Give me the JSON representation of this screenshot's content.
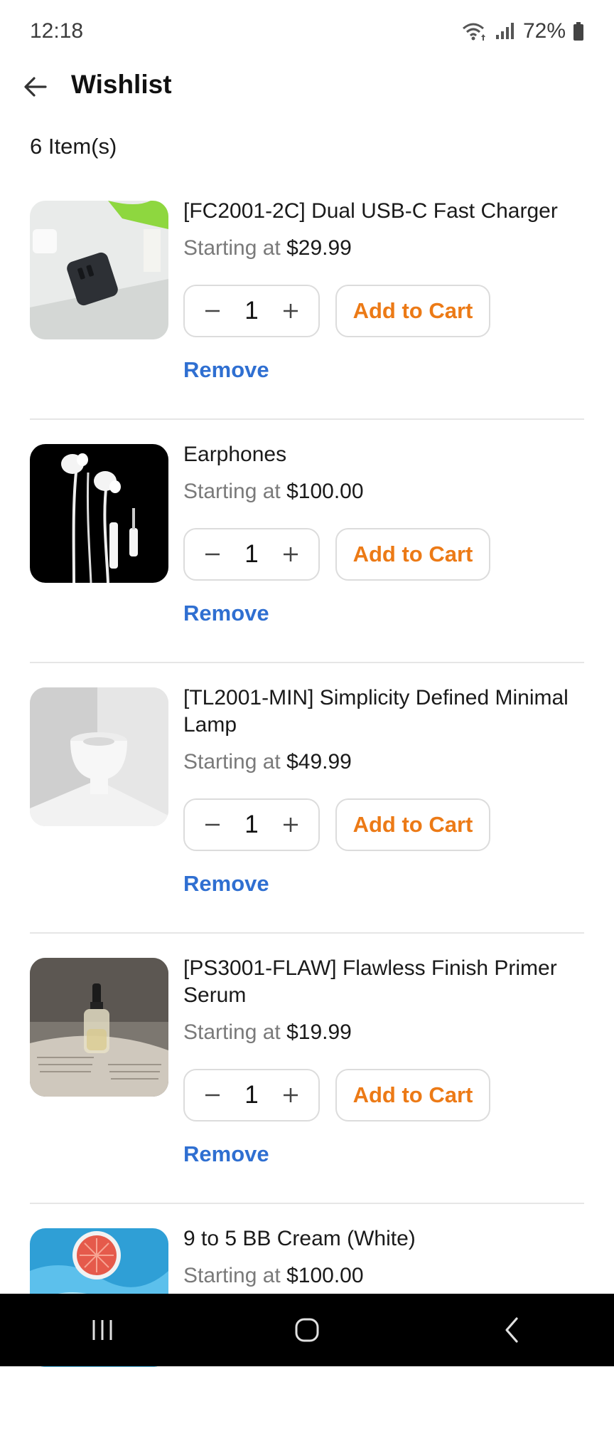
{
  "status_bar": {
    "time": "12:18",
    "battery": "72%"
  },
  "header": {
    "title": "Wishlist"
  },
  "summary": {
    "count_label": "6 Item(s)"
  },
  "items": [
    {
      "title": "[FC2001-2C] Dual USB-C Fast Charger",
      "price_prefix": "Starting at",
      "price": "$29.99",
      "qty": "1",
      "add_label": "Add to Cart",
      "remove_label": "Remove"
    },
    {
      "title": "Earphones",
      "price_prefix": "Starting at",
      "price": "$100.00",
      "qty": "1",
      "add_label": "Add to Cart",
      "remove_label": "Remove"
    },
    {
      "title": "[TL2001-MIN] Simplicity Defined Minimal Lamp",
      "price_prefix": "Starting at",
      "price": "$49.99",
      "qty": "1",
      "add_label": "Add to Cart",
      "remove_label": "Remove"
    },
    {
      "title": "[PS3001-FLAW] Flawless Finish Primer Serum",
      "price_prefix": "Starting at",
      "price": "$19.99",
      "qty": "1",
      "add_label": "Add to Cart",
      "remove_label": "Remove"
    },
    {
      "title": "9 to 5 BB Cream (White)",
      "price_prefix": "Starting at",
      "price": "$100.00"
    }
  ],
  "colors": {
    "accent_orange": "#ec7a16",
    "link_blue": "#2f6fd1"
  }
}
